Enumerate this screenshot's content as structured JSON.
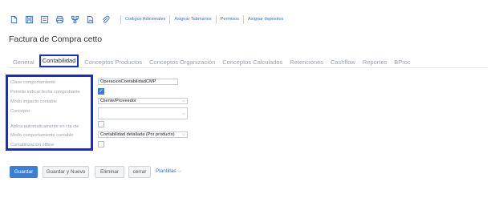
{
  "toolbar": {
    "icons": [
      "new-document-icon",
      "save-icon",
      "save-alt-icon",
      "print-icon",
      "hierarchy-icon",
      "image-icon",
      "attachment-icon"
    ],
    "links": [
      "Codigos Adicionales",
      "Asignar Tabmarios",
      "Permisos",
      "Asignar depositos"
    ]
  },
  "page": {
    "title": "Factura de Compra cetto"
  },
  "tabs": [
    {
      "label": "General"
    },
    {
      "label": "Contabilidad"
    },
    {
      "label": "Conceptos Productos"
    },
    {
      "label": "Conceptos Organización"
    },
    {
      "label": "Conceptos Calculados"
    },
    {
      "label": "Retenciones"
    },
    {
      "label": "Cashflow"
    },
    {
      "label": "Reportes"
    },
    {
      "label": "BProc"
    }
  ],
  "form": {
    "rows": [
      {
        "label": "Clase comportamiento",
        "value": "OperacionContabilidadCMP"
      },
      {
        "label": "Permite indicar fecha comprobante",
        "checked": true
      },
      {
        "label": "Modo impacto contable",
        "value": "Cliente/Proveedor"
      },
      {
        "label": "Concepto",
        "value": ""
      },
      {
        "label": "Aplica automaticamente en cta cte",
        "checked": false
      },
      {
        "label": "Modo comportamiento contable",
        "value": "Contabilidad detallada (Por producto)"
      },
      {
        "label": "Contabilizacion offline",
        "checked": false
      }
    ]
  },
  "actions": {
    "save": "Guardar",
    "save_new": "Guardar y Nuevo",
    "delete": "Eliminar",
    "close": "cerrar",
    "templates": "Plantillas"
  },
  "colors": {
    "accent": "#3a7ed6",
    "highlight": "#1a2bd6",
    "link": "#3b6fc4"
  }
}
